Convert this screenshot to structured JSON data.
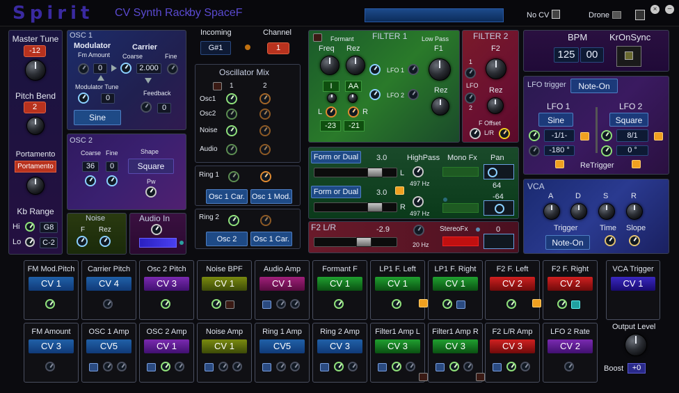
{
  "app": {
    "title": "Spirit",
    "subtitle": "CV Synth Rack",
    "author": "by SpaceF",
    "no_cv": "No CV",
    "drone": "Drone"
  },
  "left": {
    "master_tune": "Master Tune",
    "master_tune_val": "-12",
    "pitch_bend": "Pitch Bend",
    "pitch_bend_val": "2",
    "portamento": "Portamento",
    "portamento_val": "Portamento",
    "kb_range": "Kb Range",
    "hi": "Hi",
    "hi_val": "G8",
    "lo": "Lo",
    "lo_val": "C-2"
  },
  "osc1": {
    "title": "OSC 1",
    "modulator": "Modulator",
    "carrier": "Carrier",
    "fm_amount": "Fm Amount",
    "fm_amount_val": "0",
    "coarse": "Coarse",
    "fine": "Fine",
    "coarse_val": "2.000",
    "mod_tune": "Modulator Tune",
    "mod_tune_val": "0",
    "feedback": "Feedback",
    "feedback_val": "0",
    "wave": "Sine"
  },
  "osc2": {
    "title": "OSC 2",
    "coarse": "Coarse",
    "fine": "Fine",
    "shape": "Shape",
    "coarse_val": "36",
    "fine_val": "0",
    "shape_val": "Square",
    "pw": "Pw"
  },
  "noise": {
    "title": "Noise",
    "f": "F",
    "rez": "Rez"
  },
  "audio_in": {
    "title": "Audio In"
  },
  "incoming": {
    "label": "Incoming",
    "value": "G#1",
    "channel_label": "Channel",
    "channel_val": "1"
  },
  "oscmix": {
    "title": "Oscillator Mix",
    "col1": "1",
    "col2": "2",
    "rows": [
      "Osc1",
      "Osc2",
      "Noise",
      "Audio"
    ]
  },
  "ring1": {
    "title": "Ring 1",
    "a": "Osc 1 Car.",
    "b": "Osc 1 Mod."
  },
  "ring2": {
    "title": "Ring 2",
    "a": "Osc 2",
    "b": "Osc 1 Car."
  },
  "filter1": {
    "title": "FILTER 1",
    "formant": "Formant",
    "low_pass": "Low Pass",
    "freq": "Freq",
    "rez": "Rez",
    "f1": "F1",
    "rez2": "Rez",
    "lfo1": "LFO 1",
    "lfo2": "LFO 2",
    "d1": "I",
    "d2": "AA",
    "l": "L",
    "r": "R",
    "v1": "-23",
    "v2": "-21"
  },
  "filter2": {
    "title": "FILTER 2",
    "f2": "F2",
    "rez": "Rez",
    "n1": "1",
    "lfo": "LFO",
    "n2": "2",
    "f_offset": "F Offset",
    "lr": "L/R"
  },
  "mid": {
    "form_l": "Form or Dual",
    "val_l": "3.0",
    "form_r": "Form or Dual",
    "val_r": "3.0",
    "highpass": "HighPass",
    "monofx": "Mono Fx",
    "pan": "Pan",
    "hz1": "497 Hz",
    "hz2": "497 Hz",
    "pan1": "64",
    "pan2": "-64",
    "L": "L",
    "R": "R"
  },
  "f2lr": {
    "title": "F2 L/R",
    "val": "-2.9",
    "hz": "20 Hz",
    "stereofx": "StereoFx",
    "val2": "0"
  },
  "bpm": {
    "label": "BPM",
    "val1": "125",
    "val2": "00",
    "kronsync": "KrOnSync"
  },
  "lfo": {
    "trigger": "LFO trigger",
    "trigger_val": "Note-On",
    "lfo1": "LFO 1",
    "lfo2": "LFO 2",
    "wave1": "Sine",
    "wave2": "Square",
    "rate1": "-1/1-",
    "rate2": "8/1",
    "ph1": "-180 °",
    "ph2": "0 °",
    "retrigger": "ReTrigger"
  },
  "vca": {
    "title": "VCA",
    "a": "A",
    "d": "D",
    "s": "S",
    "r": "R",
    "trigger": "Trigger",
    "time": "Time",
    "slope": "Slope",
    "trigger_val": "Note-On"
  },
  "cv_row1": [
    {
      "t": "FM Mod.Pitch",
      "v": "CV 1"
    },
    {
      "t": "Carrier Pitch",
      "v": "CV 4"
    },
    {
      "t": "Osc 2 Pitch",
      "v": "CV 3"
    },
    {
      "t": "Noise BPF",
      "v": "CV 1"
    },
    {
      "t": "Audio Amp",
      "v": "CV 1"
    },
    {
      "t": "Formant F",
      "v": "CV 1"
    },
    {
      "t": "LP1 F. Left",
      "v": "CV 1"
    },
    {
      "t": "LP1 F. Right",
      "v": "CV 1"
    },
    {
      "t": "F2 F. Left",
      "v": "CV 2"
    },
    {
      "t": "F2 F. Right",
      "v": "CV 2"
    }
  ],
  "cv_row2": [
    {
      "t": "FM Amount",
      "v": "CV 3"
    },
    {
      "t": "OSC 1 Amp",
      "v": "CV5"
    },
    {
      "t": "OSC 2 Amp",
      "v": "CV 1"
    },
    {
      "t": "Noise Amp",
      "v": "CV 1"
    },
    {
      "t": "Ring 1 Amp",
      "v": "CV5"
    },
    {
      "t": "Ring 2 Amp",
      "v": "CV 3"
    },
    {
      "t": "Filter1 Amp L",
      "v": "CV 3"
    },
    {
      "t": "Filter1 Amp R",
      "v": "CV 3"
    },
    {
      "t": "F2 L/R Amp",
      "v": "CV 3"
    },
    {
      "t": "LFO 2 Rate",
      "v": "CV 2"
    }
  ],
  "vca_trigger": {
    "t": "VCA Trigger",
    "v": "CV 1"
  },
  "output": {
    "label": "Output Level",
    "boost": "Boost",
    "boost_val": "+0"
  },
  "colors": {
    "osc1_bg": "#20285a",
    "filter1_bg": "#1f6a30",
    "filter2_bg": "#7a1830",
    "accent": "#2a5aa8"
  }
}
